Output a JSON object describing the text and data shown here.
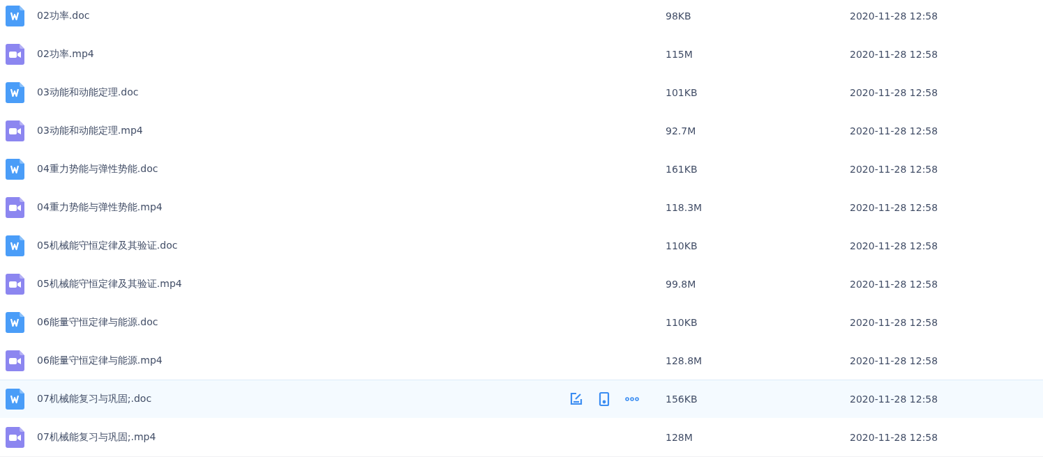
{
  "files": [
    {
      "kind": "doc",
      "name": "02功率.doc",
      "size": "98KB",
      "modified": "2020-11-28 12:58",
      "hovered": false
    },
    {
      "kind": "video",
      "name": "02功率.mp4",
      "size": "115M",
      "modified": "2020-11-28 12:58",
      "hovered": false
    },
    {
      "kind": "doc",
      "name": "03动能和动能定理.doc",
      "size": "101KB",
      "modified": "2020-11-28 12:58",
      "hovered": false
    },
    {
      "kind": "video",
      "name": "03动能和动能定理.mp4",
      "size": "92.7M",
      "modified": "2020-11-28 12:58",
      "hovered": false
    },
    {
      "kind": "doc",
      "name": "04重力势能与弹性势能.doc",
      "size": "161KB",
      "modified": "2020-11-28 12:58",
      "hovered": false
    },
    {
      "kind": "video",
      "name": "04重力势能与弹性势能.mp4",
      "size": "118.3M",
      "modified": "2020-11-28 12:58",
      "hovered": false
    },
    {
      "kind": "doc",
      "name": "05机械能守恒定律及其验证.doc",
      "size": "110KB",
      "modified": "2020-11-28 12:58",
      "hovered": false
    },
    {
      "kind": "video",
      "name": "05机械能守恒定律及其验证.mp4",
      "size": "99.8M",
      "modified": "2020-11-28 12:58",
      "hovered": false
    },
    {
      "kind": "doc",
      "name": "06能量守恒定律与能源.doc",
      "size": "110KB",
      "modified": "2020-11-28 12:58",
      "hovered": false
    },
    {
      "kind": "video",
      "name": "06能量守恒定律与能源.mp4",
      "size": "128.8M",
      "modified": "2020-11-28 12:58",
      "hovered": false
    },
    {
      "kind": "doc",
      "name": "07机械能复习与巩固;.doc",
      "size": "156KB",
      "modified": "2020-11-28 12:58",
      "hovered": true
    },
    {
      "kind": "video",
      "name": "07机械能复习与巩固;.mp4",
      "size": "128M",
      "modified": "2020-11-28 12:58",
      "hovered": false
    }
  ]
}
